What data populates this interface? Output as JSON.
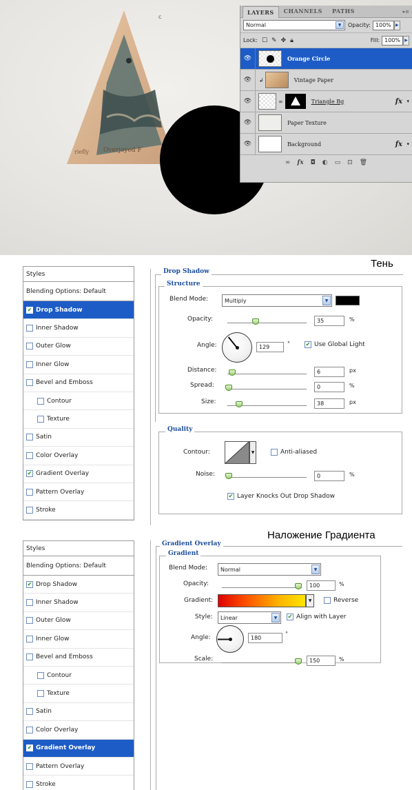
{
  "layers_panel": {
    "tabs": [
      "LAYERS",
      "CHANNELS",
      "PATHS"
    ],
    "blend_mode": "Normal",
    "opacity_label": "Opacity:",
    "opacity_value": "100%",
    "lock_label": "Lock:",
    "fill_label": "Fill:",
    "fill_value": "100%",
    "layers": [
      {
        "name": "Orange Circle",
        "selected": true,
        "fx": ""
      },
      {
        "name": "Vintage Paper",
        "selected": false,
        "fx": ""
      },
      {
        "name": "Triangle Bg",
        "selected": false,
        "fx": "fx"
      },
      {
        "name": "Paper Texture",
        "selected": false,
        "fx": ""
      },
      {
        "name": "Background",
        "selected": false,
        "fx": "fx"
      }
    ]
  },
  "canvas": {
    "triangle_text_left": "riefly",
    "triangle_text_bottom": "Overjoyed F",
    "corner_mark": "c"
  },
  "drop_shadow_dialog": {
    "title_ru": "Тень",
    "styles_header": "Styles",
    "blending_options": "Blending Options: Default",
    "styles": [
      {
        "label": "Drop Shadow",
        "checked": true,
        "active": true,
        "indent": false
      },
      {
        "label": "Inner Shadow",
        "checked": false,
        "active": false,
        "indent": false
      },
      {
        "label": "Outer Glow",
        "checked": false,
        "active": false,
        "indent": false
      },
      {
        "label": "Inner Glow",
        "checked": false,
        "active": false,
        "indent": false
      },
      {
        "label": "Bevel and Emboss",
        "checked": false,
        "active": false,
        "indent": false
      },
      {
        "label": "Contour",
        "checked": false,
        "active": false,
        "indent": true
      },
      {
        "label": "Texture",
        "checked": false,
        "active": false,
        "indent": true
      },
      {
        "label": "Satin",
        "checked": false,
        "active": false,
        "indent": false
      },
      {
        "label": "Color Overlay",
        "checked": false,
        "active": false,
        "indent": false
      },
      {
        "label": "Gradient Overlay",
        "checked": true,
        "active": false,
        "indent": false
      },
      {
        "label": "Pattern Overlay",
        "checked": false,
        "active": false,
        "indent": false
      },
      {
        "label": "Stroke",
        "checked": false,
        "active": false,
        "indent": false
      }
    ],
    "group_title": "Drop Shadow",
    "structure_title": "Structure",
    "blend_mode_label": "Blend Mode:",
    "blend_mode_value": "Multiply",
    "shadow_color": "#000000",
    "opacity_label": "Opacity:",
    "opacity_value": "35",
    "opacity_unit": "%",
    "angle_label": "Angle:",
    "angle_value": "129",
    "angle_unit": "°",
    "use_global_light_label": "Use Global Light",
    "use_global_light_checked": true,
    "distance_label": "Distance:",
    "distance_value": "6",
    "distance_unit": "px",
    "spread_label": "Spread:",
    "spread_value": "0",
    "spread_unit": "%",
    "size_label": "Size:",
    "size_value": "38",
    "size_unit": "px",
    "quality_title": "Quality",
    "contour_label": "Contour:",
    "anti_aliased_label": "Anti-aliased",
    "anti_aliased_checked": false,
    "noise_label": "Noise:",
    "noise_value": "0",
    "noise_unit": "%",
    "knocks_out_label": "Layer Knocks Out Drop Shadow",
    "knocks_out_checked": true
  },
  "gradient_overlay_dialog": {
    "title_ru": "Наложение Градиента",
    "styles_header": "Styles",
    "blending_options": "Blending Options: Default",
    "styles": [
      {
        "label": "Drop Shadow",
        "checked": true,
        "active": false,
        "indent": false
      },
      {
        "label": "Inner Shadow",
        "checked": false,
        "active": false,
        "indent": false
      },
      {
        "label": "Outer Glow",
        "checked": false,
        "active": false,
        "indent": false
      },
      {
        "label": "Inner Glow",
        "checked": false,
        "active": false,
        "indent": false
      },
      {
        "label": "Bevel and Emboss",
        "checked": false,
        "active": false,
        "indent": false
      },
      {
        "label": "Contour",
        "checked": false,
        "active": false,
        "indent": true
      },
      {
        "label": "Texture",
        "checked": false,
        "active": false,
        "indent": true
      },
      {
        "label": "Satin",
        "checked": false,
        "active": false,
        "indent": false
      },
      {
        "label": "Color Overlay",
        "checked": false,
        "active": false,
        "indent": false
      },
      {
        "label": "Gradient Overlay",
        "checked": true,
        "active": true,
        "indent": false
      },
      {
        "label": "Pattern Overlay",
        "checked": false,
        "active": false,
        "indent": false
      },
      {
        "label": "Stroke",
        "checked": false,
        "active": false,
        "indent": false
      }
    ],
    "group_title": "Gradient Overlay",
    "gradient_title": "Gradient",
    "blend_mode_label": "Blend Mode:",
    "blend_mode_value": "Normal",
    "opacity_label": "Opacity:",
    "opacity_value": "100",
    "opacity_unit": "%",
    "gradient_label": "Gradient:",
    "reverse_label": "Reverse",
    "reverse_checked": false,
    "style_label": "Style:",
    "style_value": "Linear",
    "align_label": "Align with Layer",
    "align_checked": true,
    "angle_label": "Angle:",
    "angle_value": "180",
    "angle_unit": "°",
    "scale_label": "Scale:",
    "scale_value": "150",
    "scale_unit": "%"
  }
}
